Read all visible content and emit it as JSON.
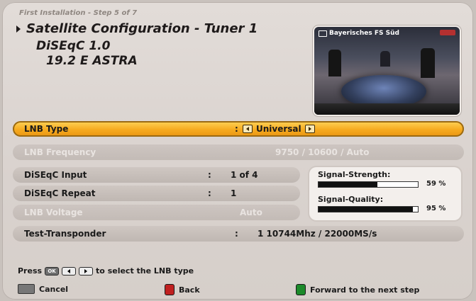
{
  "header": {
    "step": "First Installation - Step 5 of 7",
    "title": "Satellite Configuration - Tuner 1",
    "diseqc_mode": "DiSEqC 1.0",
    "satellite": "19.2 E ASTRA"
  },
  "preview": {
    "channel": "Bayerisches FS Süd"
  },
  "rows": {
    "lnb_type": {
      "label": "LNB Type",
      "colon": ":",
      "value": "Universal"
    },
    "lnb_frequency": {
      "label": "LNB Frequency",
      "value": "9750 / 10600 / Auto"
    },
    "diseqc_input": {
      "label": "DiSEqC Input",
      "colon": ":",
      "value": "1 of 4"
    },
    "diseqc_repeat": {
      "label": "DiSEqC Repeat",
      "colon": ":",
      "value": "1"
    },
    "lnb_voltage": {
      "label": "LNB Voltage",
      "value": "Auto"
    },
    "test_transponder": {
      "label": "Test-Transponder",
      "colon": ":",
      "value": "1  10744Mhz / 22000MS/s"
    }
  },
  "signal": {
    "strength_label": "Signal-Strength:",
    "strength_value": "59 %",
    "strength_fraction": 0.59,
    "quality_label": "Signal-Quality:",
    "quality_value": "95 %",
    "quality_fraction": 0.95
  },
  "hint": {
    "press": "Press",
    "ok_key": "OK",
    "text": "to select the LNB type"
  },
  "footer": {
    "cancel": "Cancel",
    "back": "Back",
    "forward": "Forward to the next step"
  },
  "colors": {
    "selected_row": "#f6aa1f",
    "panel": "#dcd6d2"
  }
}
